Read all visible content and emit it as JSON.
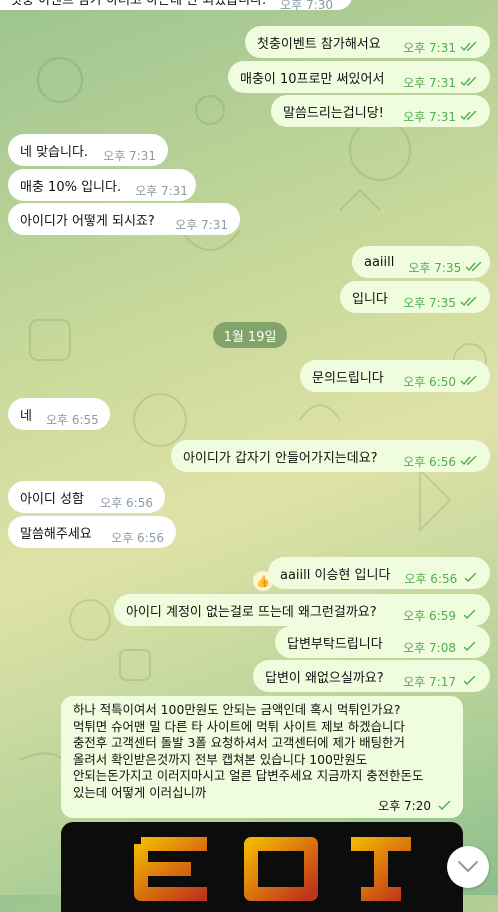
{
  "colors": {
    "outgoing_bubble": "#effdde",
    "incoming_bubble": "#ffffff",
    "read_ticks": "#4fae4e",
    "date_chip": "#689258"
  },
  "top_fragment": {
    "text": "첫충 이벤트 참가 하려고 하는데 안 되었습니다.",
    "time": "오후 7:30"
  },
  "messages": [
    {
      "text": "첫충이벤트 참가해서요",
      "time": "오후 7:31"
    },
    {
      "text": "매충이 10프로만 써있어서",
      "time": "오후 7:31"
    },
    {
      "text": "말씀드리는겁니당!",
      "time": "오후 7:31"
    },
    {
      "text": "네 맞습니다.",
      "time": "오후 7:31"
    },
    {
      "text": "매충 10% 입니다.",
      "time": "오후 7:31"
    },
    {
      "text": "아이디가 어떻게 되시죠?",
      "time": "오후 7:31"
    },
    {
      "text": "aaiill",
      "time": "오후 7:35"
    },
    {
      "text": "입니다",
      "time": "오후 7:35"
    },
    {
      "text": "문의드립니다",
      "time": "오후 6:50"
    },
    {
      "text": "네",
      "time": "오후 6:55"
    },
    {
      "text": "아이디가 갑자기 안들어가지는데요?",
      "time": "오후 6:56"
    },
    {
      "text": "아이디 성함",
      "time": "오후 6:56"
    },
    {
      "text": "말씀해주세요",
      "time": "오후 6:56"
    },
    {
      "text": "aaiill 이승현 입니다",
      "time": "오후 6:56"
    },
    {
      "text": "아이디 계정이 없는걸로 뜨는데 왜그런걸까요?",
      "time": "오후 6:59"
    },
    {
      "text": "답변부탁드립니다",
      "time": "오후 7:08"
    },
    {
      "text": "답변이 왜없으실까요?",
      "time": "오후 7:17"
    }
  ],
  "date_separator": "1월 19일",
  "reaction": "👍",
  "long_message": {
    "lines": [
      "하나 적특이여서 100만원도 안되는 금액인데 혹시 먹튀인가요?",
      "먹튀면 슈어맨 밀 다른 타 사이트에 먹튀 사이트 제보 하겠습니다",
      "충전후 고객센터 돌발 3폴 요청하셔서 고객센터에 제가 배팅한거",
      "올려서 확인받은것까지 전부 캡쳐본 있습니다 100만원도",
      "안되는돈가지고 이러지마시고 얼른 답변주세요 지금까지 충전한돈도",
      "있는데 어떻게 이러십니까"
    ],
    "time": "오후 7:20"
  },
  "icons": {
    "read": "double-check-icon",
    "sent": "check-icon",
    "scroll": "chevron-down-icon"
  }
}
